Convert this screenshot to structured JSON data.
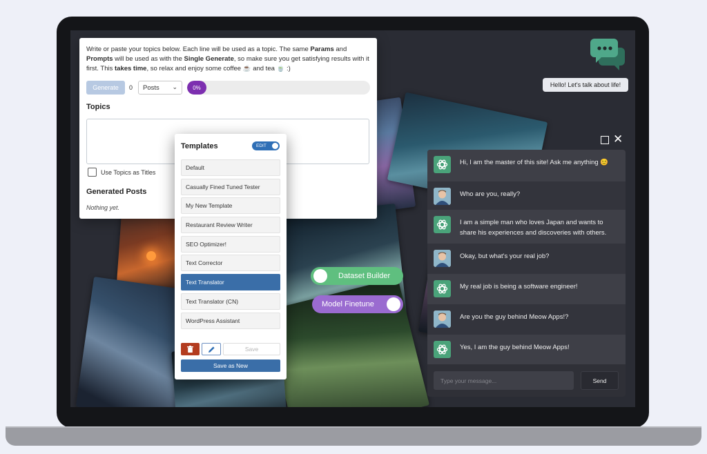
{
  "generator": {
    "intro_parts": [
      "Write or paste your topics below. Each line will be used as a topic. The same ",
      "Params",
      " and ",
      "Prompts",
      " will be used as with the ",
      "Single Generate",
      ", so make sure you get satisfying results with it first. This ",
      "takes time",
      ", so relax and enjoy some coffee ☕ and tea 🍵 :)"
    ],
    "generate_label": "Generate",
    "count": "0",
    "type_selected": "Posts",
    "progress_label": "0%",
    "progress_fraction": 0.1,
    "topics_heading": "Topics",
    "topics_value": "",
    "use_topics_label": "Use Topics as Titles",
    "generated_heading": "Generated Posts",
    "nothing_label": "Nothing yet."
  },
  "templates": {
    "title": "Templates",
    "edit_label": "EDIT",
    "items": [
      {
        "label": "Default",
        "active": false
      },
      {
        "label": "Casually Fined Tuned Tester",
        "active": false
      },
      {
        "label": "My New Template",
        "active": false
      },
      {
        "label": "Restaurant Review Writer",
        "active": false
      },
      {
        "label": "SEO Optimizer!",
        "active": false
      },
      {
        "label": "Text Corrector",
        "active": false
      },
      {
        "label": "Text Translator",
        "active": true
      },
      {
        "label": "Text Translator (CN)",
        "active": false
      },
      {
        "label": "WordPress Assistant",
        "active": false
      }
    ],
    "save_label": "Save",
    "save_as_new_label": "Save as New"
  },
  "toggles": {
    "dataset_label": "Dataset Builder",
    "model_label": "Model Finetune"
  },
  "chat": {
    "greeting": "Hello! Let's talk about life!",
    "messages": [
      {
        "role": "ai",
        "text": "Hi, I am the master of this site! Ask me anything 😊"
      },
      {
        "role": "user",
        "text": "Who are you, really?"
      },
      {
        "role": "ai",
        "text": "I am a simple man who loves Japan and wants to share his experiences and discoveries with others."
      },
      {
        "role": "user",
        "text": "Okay, but what's your real job?"
      },
      {
        "role": "ai",
        "text": "My real job is being a software engineer!"
      },
      {
        "role": "user",
        "text": "Are you the guy behind Meow Apps!?"
      },
      {
        "role": "ai",
        "text": "Yes, I am the guy behind Meow Apps!"
      }
    ],
    "input_placeholder": "Type your message...",
    "send_label": "Send"
  },
  "colors": {
    "accent_blue": "#3a6ea8",
    "progress_purple": "#7d2fb0",
    "ai_green": "#4aa37a",
    "dataset_green": "#5fbf7f",
    "model_purple": "#9a6bd0"
  },
  "icons": {
    "delete": "trash-icon",
    "edit": "pencil-icon",
    "ai_avatar": "openai-logo-icon",
    "chat_logo": "chat-bubbles-icon"
  }
}
